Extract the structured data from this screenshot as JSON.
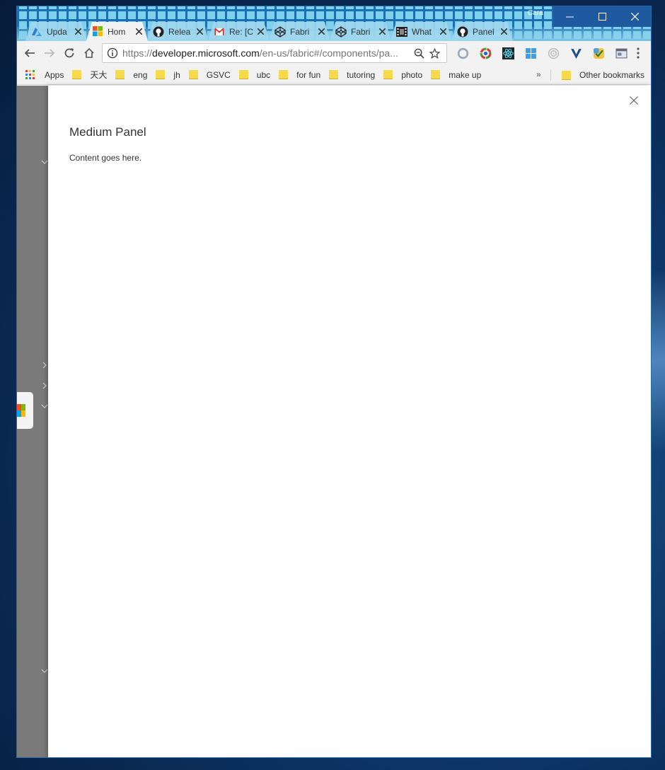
{
  "browser": {
    "profile_name": "Cara",
    "tabs": [
      {
        "title": "Upda",
        "icon": "azure-icon",
        "active": false
      },
      {
        "title": "Hom",
        "icon": "microsoft-icon",
        "active": true
      },
      {
        "title": "Relea",
        "icon": "github-icon",
        "active": false
      },
      {
        "title": "Re: [C",
        "icon": "gmail-icon",
        "active": false
      },
      {
        "title": "Fabri",
        "icon": "codepen-icon",
        "active": false
      },
      {
        "title": "Fabri",
        "icon": "codepen-icon",
        "active": false
      },
      {
        "title": "What",
        "icon": "film-icon",
        "active": false
      },
      {
        "title": "Panel",
        "icon": "github-icon",
        "active": false
      }
    ],
    "url_scheme": "https://",
    "url_host": "developer.microsoft.com",
    "url_path": "/en-us/fabric#/components/pa...",
    "bookmarks": [
      {
        "label": "Apps",
        "icon": "apps-grid-icon"
      },
      {
        "label": "天大",
        "icon": "folder-icon"
      },
      {
        "label": "eng",
        "icon": "folder-icon"
      },
      {
        "label": "jh",
        "icon": "folder-icon"
      },
      {
        "label": "GSVC",
        "icon": "folder-icon"
      },
      {
        "label": "ubc",
        "icon": "folder-icon"
      },
      {
        "label": "for fun",
        "icon": "folder-icon"
      },
      {
        "label": "tutoring",
        "icon": "folder-icon"
      },
      {
        "label": "photo",
        "icon": "folder-icon"
      },
      {
        "label": "make up",
        "icon": "folder-icon"
      }
    ],
    "bookmarks_more": "»",
    "other_bookmarks": "Other bookmarks"
  },
  "panel": {
    "title": "Medium Panel",
    "content": "Content goes here."
  },
  "colors": {
    "accent": "#1f5aa0",
    "overlay": "#7a7a7a",
    "folder": "#f7d94c"
  }
}
